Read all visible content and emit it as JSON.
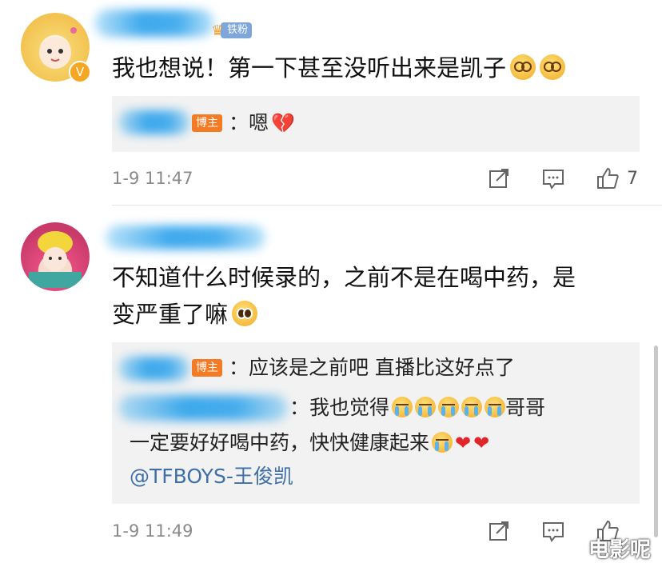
{
  "comments": [
    {
      "fan_badge": "铁粉",
      "text": "我也想说！第一下甚至没听出来是凯子",
      "reply": {
        "host_badge": "博主",
        "text": "：嗯"
      },
      "time": "1-9 11:47",
      "likes": "7"
    },
    {
      "text_line1": "不知道什么时候录的，之前不是在喝中药，是",
      "text_line2": "变严重了嘛",
      "replies": [
        {
          "host_badge": "博主",
          "text": "：应该是之前吧 直播比这好点了"
        },
        {
          "text_a": "：我也觉得",
          "text_b": "哥哥",
          "text_c": "一定要好好喝中药，快快健康起来",
          "mention": "@TFBOYS-王俊凯"
        }
      ],
      "time": "1-9 11:49"
    }
  ],
  "watermark": "电影呢",
  "colors": {
    "host_badge": "#f47a23",
    "fan_badge": "#7fa6d9",
    "mention": "#3f6fa8",
    "reply_bg": "#f2f2f2"
  },
  "icons": [
    "share-icon",
    "comment-icon",
    "like-icon"
  ]
}
